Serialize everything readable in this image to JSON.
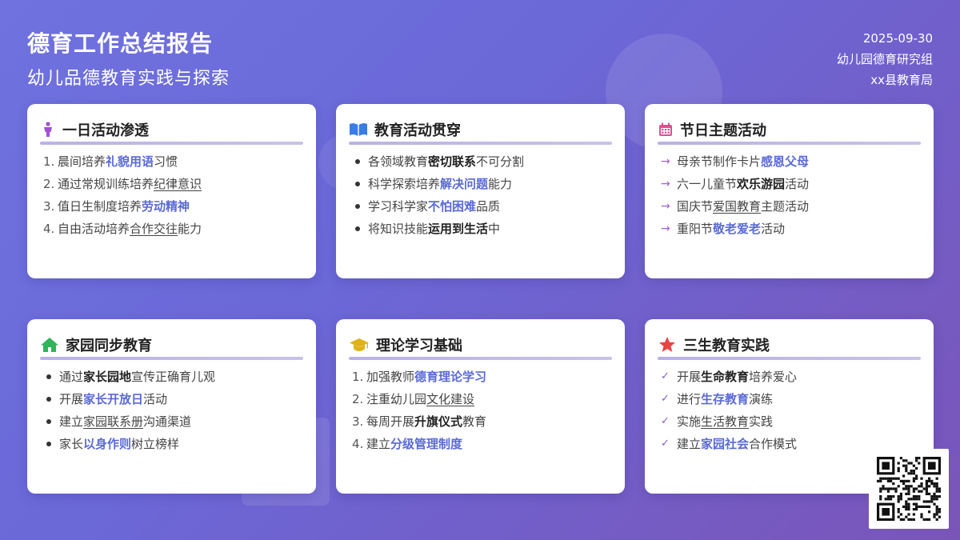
{
  "header": {
    "title": "德育工作总结报告",
    "subtitle": "幼儿品德教育实践与探索",
    "date": "2025-09-30",
    "org": "幼儿园德育研究组",
    "authority": "xx县教育局"
  },
  "cards": [
    {
      "title": "一日活动渗透",
      "icon": "child-icon",
      "items": [
        {
          "marker": "1.",
          "pre": "晨间培养",
          "em": "礼貌用语",
          "post": "习惯"
        },
        {
          "marker": "2.",
          "pre": "通过常规训练培养",
          "em": "纪律意识",
          "post": ""
        },
        {
          "marker": "3.",
          "pre": "值日生制度培养",
          "em": "劳动精神",
          "post": ""
        },
        {
          "marker": "4.",
          "pre": "自由活动培养",
          "em": "合作交往",
          "post": "能力"
        }
      ]
    },
    {
      "title": "教育活动贯穿",
      "icon": "open-book-icon",
      "items": [
        {
          "pre": "各领域教育",
          "em": "密切联系",
          "post": "不可分割"
        },
        {
          "pre": "科学探索培养",
          "em": "解决问题",
          "post": "能力"
        },
        {
          "pre": "学习科学家",
          "em": "不怕困难",
          "post": "品质"
        },
        {
          "pre": "将知识技能",
          "em": "运用到生活",
          "post": "中"
        }
      ]
    },
    {
      "title": "节日主题活动",
      "icon": "calendar-icon",
      "items": [
        {
          "pre": "母亲节制作卡片",
          "em": "感恩父母",
          "post": ""
        },
        {
          "pre": "六一儿童节",
          "em": "欢乐游园",
          "post": "活动"
        },
        {
          "pre": "国庆节",
          "em": "爱国教育",
          "post": "主题活动"
        },
        {
          "pre": "重阳节",
          "em": "敬老爱老",
          "post": "活动"
        }
      ]
    },
    {
      "title": "家园同步教育",
      "icon": "home-icon",
      "items": [
        {
          "pre": "通过",
          "em": "家长园地",
          "post": "宣传正确育儿观"
        },
        {
          "pre": "开展",
          "em": "家长开放日",
          "post": "活动"
        },
        {
          "pre": "建立",
          "em": "家园联系册",
          "post": "沟通渠道"
        },
        {
          "pre": "家长",
          "em": "以身作则",
          "post": "树立榜样"
        }
      ]
    },
    {
      "title": "理论学习基础",
      "icon": "graduation-cap-icon",
      "items": [
        {
          "marker": "1.",
          "pre": "加强教师",
          "em": "德育理论学习",
          "post": ""
        },
        {
          "marker": "2.",
          "pre": "注重幼儿园",
          "em": "文化建设",
          "post": ""
        },
        {
          "marker": "3.",
          "pre": "每周开展",
          "em": "升旗仪式",
          "post": "教育"
        },
        {
          "marker": "4.",
          "pre": "建立",
          "em": "分级管理制度",
          "post": ""
        }
      ]
    },
    {
      "title": "三生教育实践",
      "icon": "star-icon",
      "items": [
        {
          "pre": "开展",
          "em": "生命教育",
          "post": "培养爱心"
        },
        {
          "pre": "进行",
          "em": "生存教育",
          "post": "演练"
        },
        {
          "pre": "实施",
          "em": "生活教育",
          "post": "实践"
        },
        {
          "pre": "建立",
          "em": "家园社会",
          "post": "合作模式"
        }
      ]
    }
  ],
  "qr_code": {
    "icon": "qr-code-icon"
  },
  "colors": {
    "accent": "#5a6ad6",
    "background_start": "#6f72df",
    "background_end": "#7a55b8"
  }
}
